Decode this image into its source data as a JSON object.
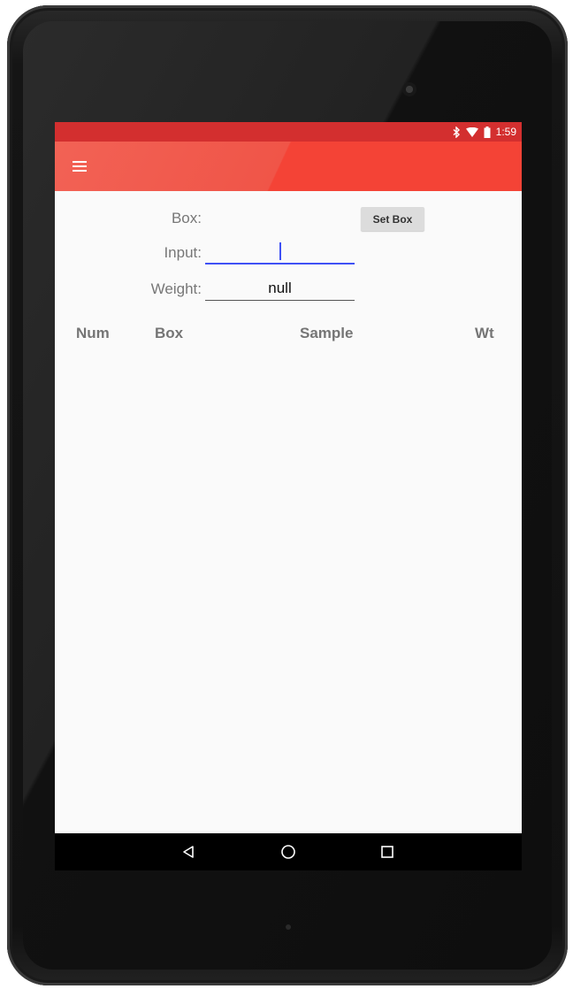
{
  "status_bar": {
    "time": "1:59",
    "icons": [
      "bluetooth-icon",
      "wifi-icon",
      "battery-icon"
    ],
    "color": "#d32f2f"
  },
  "app_bar": {
    "color": "#f44336",
    "menu_icon": "hamburger-menu-icon"
  },
  "form": {
    "box_label": "Box:",
    "set_box_label": "Set Box",
    "input_label": "Input:",
    "input_value": "",
    "weight_label": "Weight:",
    "weight_value": "null"
  },
  "table": {
    "columns": [
      "Num",
      "Box",
      "Sample",
      "Wt"
    ],
    "rows": []
  },
  "nav_bar": {
    "buttons": [
      "back-icon",
      "home-icon",
      "recents-icon"
    ]
  }
}
